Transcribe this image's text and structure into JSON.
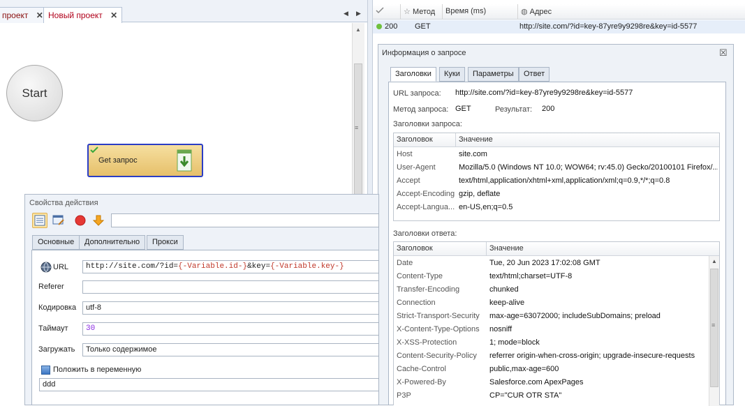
{
  "editor": {
    "tabs": [
      {
        "label": "проект"
      },
      {
        "label": "Новый проект"
      }
    ],
    "close_glyph": "✕",
    "nav_prev": "◀",
    "nav_next": "▶",
    "start_node": "Start",
    "action_node": "Get запрос"
  },
  "request_list": {
    "columns": [
      "Метод",
      "Время (ms)",
      "Адрес"
    ],
    "row": {
      "status": "200",
      "method": "GET",
      "url": "http://site.com/?id=key-87yre9y9298re&key=id-5577"
    },
    "status_color": "#6fc13e"
  },
  "info": {
    "title": "Информация о запросе",
    "close_glyph": "☒",
    "tabs": [
      "Заголовки",
      "Куки",
      "Параметры",
      "Ответ"
    ],
    "url_label": "URL запроса:",
    "url_value": "http://site.com/?id=key-87yre9y9298re&key=id-5577",
    "method_label": "Метод запроса:",
    "method_value": "GET",
    "result_label": "Результат:",
    "result_value": "200",
    "req_headers_label": "Заголовки запроса:",
    "resp_headers_label": "Заголовки ответа:",
    "col_header": "Заголовок",
    "col_value": "Значение",
    "request_headers": [
      {
        "k": "Host",
        "v": "site.com"
      },
      {
        "k": "User-Agent",
        "v": "Mozilla/5.0 (Windows NT 10.0; WOW64; rv:45.0) Gecko/20100101 Firefox/..."
      },
      {
        "k": "Accept",
        "v": "text/html,application/xhtml+xml,application/xml;q=0.9,*/*;q=0.8"
      },
      {
        "k": "Accept-Encoding",
        "v": "gzip, deflate"
      },
      {
        "k": "Accept-Langua...",
        "v": "en-US,en;q=0.5"
      }
    ],
    "response_headers": [
      {
        "k": "Date",
        "v": "Tue, 20 Jun 2023 17:02:08 GMT"
      },
      {
        "k": "Content-Type",
        "v": "text/html;charset=UTF-8"
      },
      {
        "k": "Transfer-Encoding",
        "v": "chunked"
      },
      {
        "k": "Connection",
        "v": "keep-alive"
      },
      {
        "k": "Strict-Transport-Security",
        "v": "max-age=63072000; includeSubDomains; preload"
      },
      {
        "k": "X-Content-Type-Options",
        "v": "nosniff"
      },
      {
        "k": "X-XSS-Protection",
        "v": "1; mode=block"
      },
      {
        "k": "Content-Security-Policy",
        "v": "referrer origin-when-cross-origin; upgrade-insecure-requests"
      },
      {
        "k": "Cache-Control",
        "v": "public,max-age=600"
      },
      {
        "k": "X-Powered-By",
        "v": "Salesforce.com ApexPages"
      },
      {
        "k": "P3P",
        "v": "CP=\"CUR OTR STA\""
      }
    ]
  },
  "props": {
    "title": "Свойства действия",
    "tabs": [
      "Основные",
      "Дополнительно",
      "Прокси"
    ],
    "url_label": "URL",
    "url_prefix": "http://site.com/?id=",
    "var1": "{-Variable.id-}",
    "url_mid": "&key=",
    "var2": "{-Variable.key-}",
    "referer_label": "Referer",
    "referer_value": "",
    "encoding_label": "Кодировка",
    "encoding_value": "utf-8",
    "timeout_label": "Таймаут",
    "timeout_value": "30",
    "load_label": "Загружать",
    "load_value": "Только содержимое",
    "put_var_label": "Положить в переменную",
    "var_value": "ddd"
  }
}
